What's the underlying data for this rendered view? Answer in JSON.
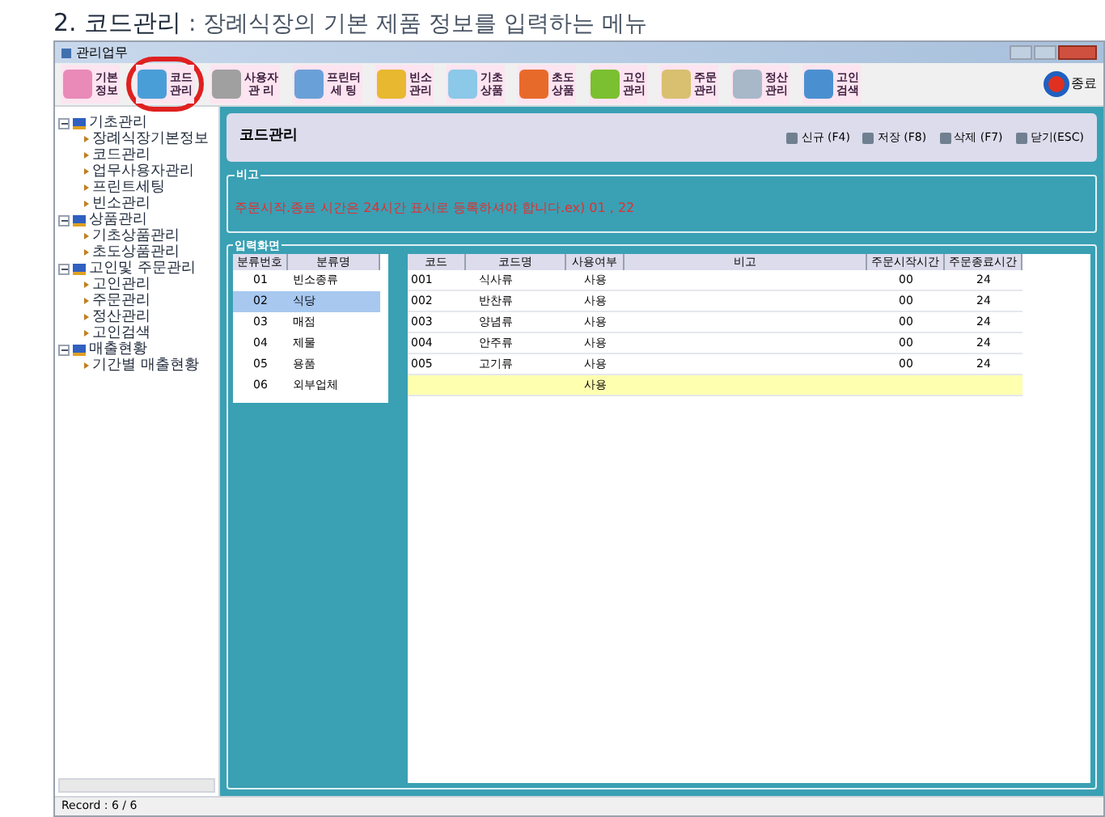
{
  "heading": {
    "number": "2.",
    "title": "코드관리",
    "description": " : 장례식장의 기본 제품 정보를 입력하는 메뉴"
  },
  "window": {
    "title": "관리업무"
  },
  "toolbar": [
    {
      "lines": [
        "기본",
        "정보"
      ],
      "highlighted": false
    },
    {
      "lines": [
        "코드",
        "관리"
      ],
      "highlighted": true
    },
    {
      "lines": [
        "사용자",
        "관 리"
      ],
      "highlighted": false
    },
    {
      "lines": [
        "프린터",
        "세 팅"
      ],
      "highlighted": false
    },
    {
      "lines": [
        "빈소",
        "관리"
      ],
      "highlighted": false
    },
    {
      "lines": [
        "기초",
        "상품"
      ],
      "highlighted": false
    },
    {
      "lines": [
        "초도",
        "상품"
      ],
      "highlighted": false
    },
    {
      "lines": [
        "고인",
        "관리"
      ],
      "highlighted": false
    },
    {
      "lines": [
        "주문",
        "관리"
      ],
      "highlighted": false
    },
    {
      "lines": [
        "정산",
        "관리"
      ],
      "highlighted": false
    },
    {
      "lines": [
        "고인",
        "검색"
      ],
      "highlighted": false
    }
  ],
  "exit_button": "종료",
  "tree": [
    {
      "label": "기초관리",
      "expanded": true,
      "children": [
        {
          "label": "장례식장기본정보"
        },
        {
          "label": "코드관리"
        },
        {
          "label": "업무사용자관리"
        },
        {
          "label": "프린트세팅"
        },
        {
          "label": "빈소관리"
        }
      ]
    },
    {
      "label": "상품관리",
      "expanded": true,
      "children": [
        {
          "label": "기초상품관리"
        },
        {
          "label": "초도상품관리"
        }
      ]
    },
    {
      "label": "고인및 주문관리",
      "expanded": true,
      "children": [
        {
          "label": "고인관리"
        },
        {
          "label": "주문관리"
        },
        {
          "label": "정산관리"
        },
        {
          "label": "고인검색"
        }
      ]
    },
    {
      "label": "매출현황",
      "expanded": true,
      "children": [
        {
          "label": "기간별 매출현황"
        }
      ]
    }
  ],
  "header": {
    "title": "코드관리",
    "actions": [
      "신규 (F4)",
      "저장 (F8)",
      "삭제 (F7)",
      "닫기(ESC)"
    ]
  },
  "note": {
    "legend": "비고",
    "text": "주문시작.종료 시간은 24시간 표시로 등록하셔야 합니다.ex) 01 , 22"
  },
  "input_area": {
    "legend": "입력화면",
    "category_table": {
      "columns": [
        "분류번호",
        "분류명"
      ],
      "rows": [
        {
          "cells": [
            "01",
            "빈소종류"
          ],
          "selected": false
        },
        {
          "cells": [
            "02",
            "식당"
          ],
          "selected": true
        },
        {
          "cells": [
            "03",
            "매점"
          ],
          "selected": false
        },
        {
          "cells": [
            "04",
            "제물"
          ],
          "selected": false
        },
        {
          "cells": [
            "05",
            "용품"
          ],
          "selected": false
        },
        {
          "cells": [
            "06",
            "외부업체"
          ],
          "selected": false
        }
      ]
    },
    "code_table": {
      "columns": [
        "코드",
        "코드명",
        "사용여부",
        "비고",
        "주문시작시간",
        "주문종료시간"
      ],
      "rows": [
        {
          "kind": "data",
          "cells": [
            "001",
            "식사류",
            "사용",
            "",
            "00",
            "24"
          ]
        },
        {
          "kind": "data",
          "cells": [
            "002",
            "반찬류",
            "사용",
            "",
            "00",
            "24"
          ]
        },
        {
          "kind": "data",
          "cells": [
            "003",
            "양념류",
            "사용",
            "",
            "00",
            "24"
          ]
        },
        {
          "kind": "data",
          "cells": [
            "004",
            "안주류",
            "사용",
            "",
            "00",
            "24"
          ]
        },
        {
          "kind": "data",
          "cells": [
            "005",
            "고기류",
            "사용",
            "",
            "00",
            "24"
          ]
        },
        {
          "kind": "new",
          "cells": [
            "",
            "",
            "사용",
            "",
            "",
            ""
          ]
        }
      ]
    }
  },
  "status_bar": "Record : 6 / 6"
}
